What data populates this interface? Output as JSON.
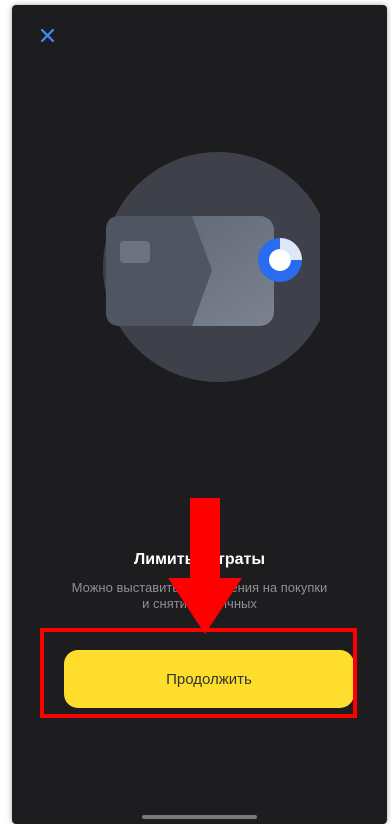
{
  "onboarding": {
    "title": "Лимиты и траты",
    "subtitle_line1": "Можно выставить ограничения на покупки",
    "subtitle_line2": "и снятие наличных",
    "continue_label": "Продолжить"
  },
  "colors": {
    "background": "#1d1d1f",
    "accent_button": "#ffdd2d",
    "close_icon": "#428bf9",
    "annotation_red": "#ff0000",
    "ring_blue": "#2a6cf0"
  },
  "icons": {
    "close": "close-icon",
    "card": "bank-card-icon",
    "progress": "progress-ring-icon"
  }
}
